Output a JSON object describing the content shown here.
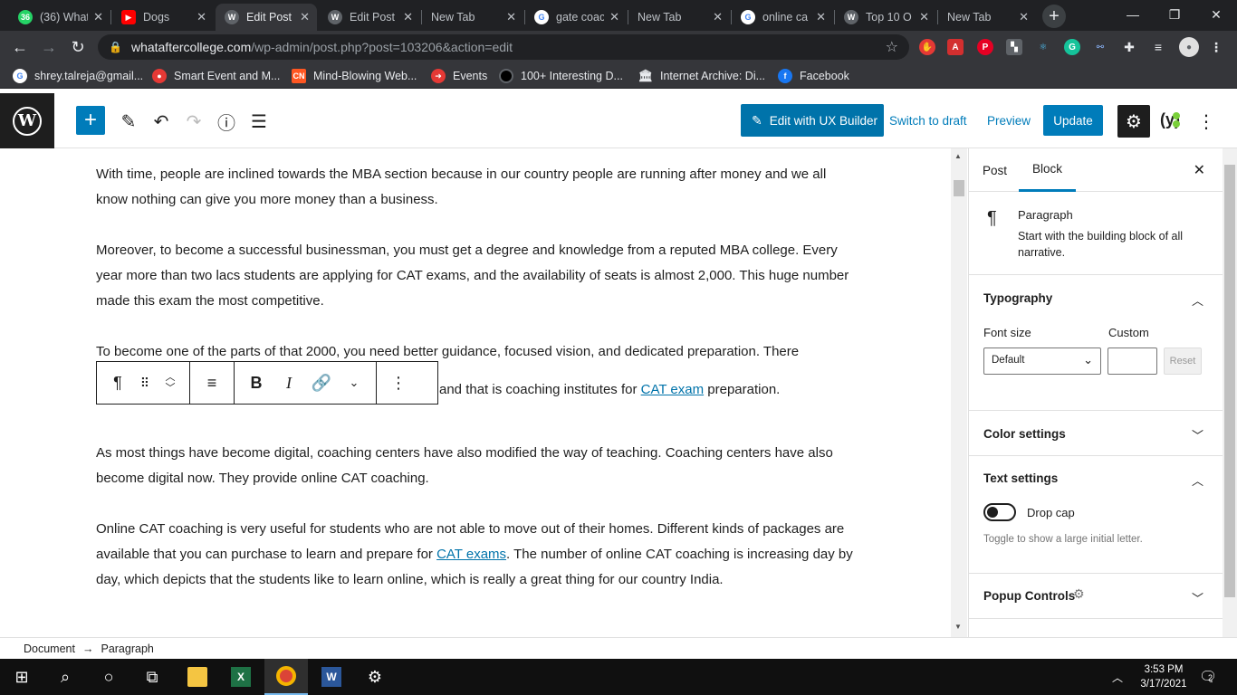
{
  "browser": {
    "tabs": [
      {
        "label": "(36) What",
        "icon": "whatsapp-icon",
        "color": "#25d366",
        "badge": "36",
        "active": false
      },
      {
        "label": "Dogs",
        "icon": "youtube-icon",
        "color": "#ff0000",
        "active": false
      },
      {
        "label": "Edit Post",
        "icon": "wordpress-icon",
        "color": "#555555",
        "active": true
      },
      {
        "label": "Edit Post",
        "icon": "wordpress-icon",
        "color": "#555555",
        "active": false
      },
      {
        "label": "New Tab",
        "icon": "",
        "color": "",
        "active": false
      },
      {
        "label": "gate coac",
        "icon": "google-icon",
        "color": "#ffffff",
        "active": false
      },
      {
        "label": "New Tab",
        "icon": "",
        "color": "",
        "active": false
      },
      {
        "label": "online ca",
        "icon": "google-icon",
        "color": "#ffffff",
        "active": false
      },
      {
        "label": "Top 10 O",
        "icon": "wordpress-icon",
        "color": "#555555",
        "active": false
      },
      {
        "label": "New Tab",
        "icon": "",
        "color": "",
        "active": false
      }
    ],
    "url_domain": "whataftercollege.com",
    "url_path": "/wp-admin/post.php?post=103206&action=edit",
    "bookmarks": [
      {
        "label": "shrey.talreja@gmail...",
        "icon": "google-icon",
        "color": "#ffffff"
      },
      {
        "label": "Smart Event and M...",
        "icon": "event-icon",
        "color": "#e53935"
      },
      {
        "label": "Mind-Blowing Web...",
        "icon": "cn-icon",
        "color": "#ff5722",
        "text": "CN"
      },
      {
        "label": "Events",
        "icon": "events-icon",
        "color": "#e53935"
      },
      {
        "label": "100+ Interesting D...",
        "icon": "circle-icon",
        "color": "#000000"
      },
      {
        "label": "Internet Archive: Di...",
        "icon": "archive-icon",
        "color": "#ffffff"
      },
      {
        "label": "Facebook",
        "icon": "facebook-icon",
        "color": "#1877f2",
        "text": "f"
      }
    ]
  },
  "editor": {
    "header": {
      "ux_builder": "Edit with UX Builder",
      "switch_draft": "Switch to draft",
      "preview": "Preview",
      "update": "Update"
    },
    "paragraphs": [
      {
        "text": "With time, people are inclined towards the MBA section because in our country people are running after money and we all know nothing can give you more money than a business."
      },
      {
        "text": "Moreover, to become a successful businessman, you must get a degree and knowledge from a reputed MBA college. Every year more than two lacs students are applying for CAT exams, and the availability of seats is almost 2,000. This huge number made this exam the most competitive."
      },
      {
        "text": "To become one of the parts of that 2000, you need better guidance, focused vision, and dedicated preparation. There"
      },
      {
        "pre": "and that is coaching institutes for ",
        "link": "CAT exam",
        "post": " preparation."
      },
      {
        "text": "As most things have become digital, coaching centers have also modified the way of teaching. Coaching centers have also become digital now. They provide online CAT coaching."
      },
      {
        "pre": "Online CAT coaching is very useful for students who are not able to move out of their homes. Different kinds of packages are available that you can purchase to learn and prepare for ",
        "link": "CAT exams",
        "post": ". The number of online CAT coaching is increasing day by day, which depicts that the students like to learn online, which is really a great thing for our country India."
      }
    ]
  },
  "sidebar": {
    "tab_post": "Post",
    "tab_block": "Block",
    "block_name": "Paragraph",
    "block_desc": "Start with the building block of all narrative.",
    "typography": "Typography",
    "font_size_label": "Font size",
    "custom_label": "Custom",
    "font_size_value": "Default",
    "reset": "Reset",
    "color_settings": "Color settings",
    "text_settings": "Text settings",
    "drop_cap": "Drop cap",
    "drop_cap_help": "Toggle to show a large initial letter.",
    "popup_controls": "Popup Controls"
  },
  "footer": {
    "crumb_document": "Document",
    "arrow": "→",
    "crumb_paragraph": "Paragraph"
  },
  "taskbar": {
    "time": "3:53 PM",
    "date": "3/17/2021",
    "notifications": "2"
  }
}
